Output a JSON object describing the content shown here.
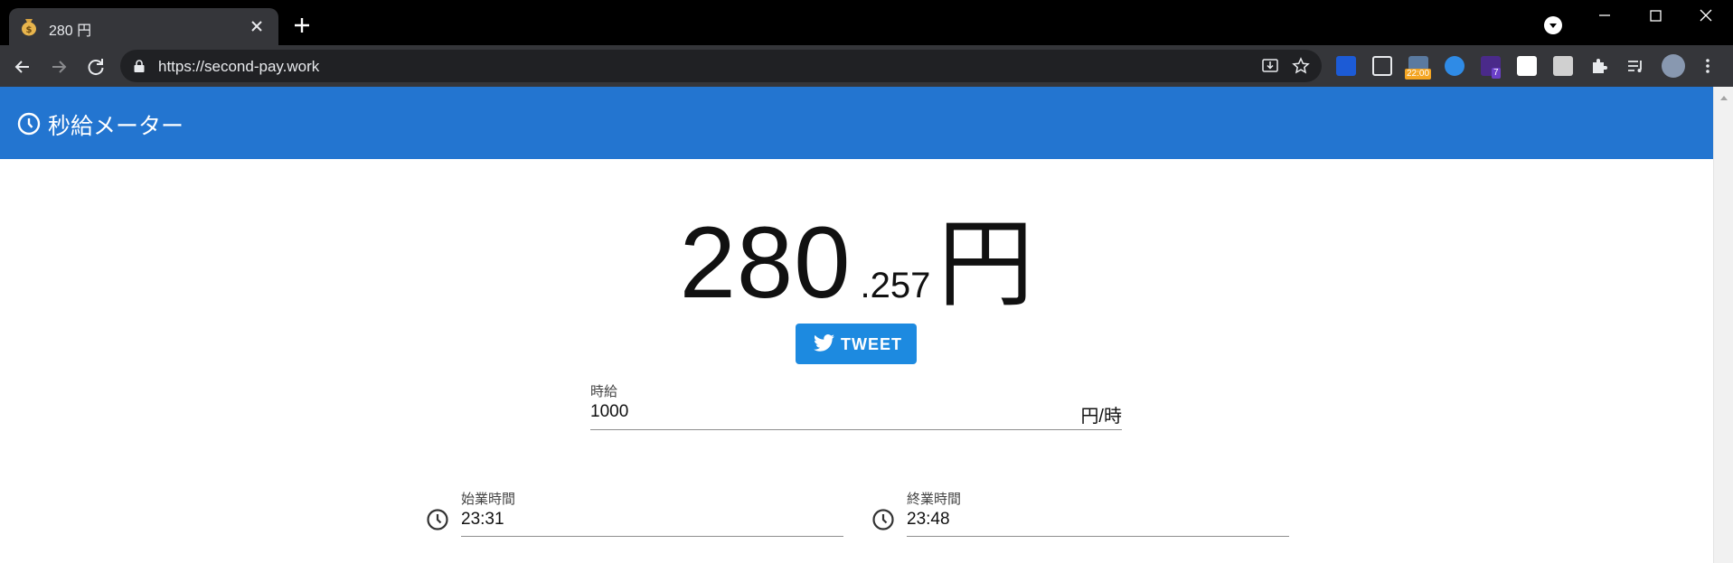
{
  "browser": {
    "tab_title": "280 円",
    "url": "https://second-pay.work",
    "extension_badges": {
      "clock": "22:00",
      "count": "7"
    }
  },
  "app": {
    "title": "秒給メーター",
    "accent_color": "#2375d0"
  },
  "meter": {
    "integer": "280",
    "decimal": ".257",
    "unit": "円"
  },
  "tweet_button": {
    "label": "TWEET",
    "color": "#1d8ae0"
  },
  "form": {
    "hourly_wage": {
      "label": "時給",
      "value": "1000",
      "suffix": "円/時"
    },
    "start_time": {
      "label": "始業時間",
      "value": "23:31"
    },
    "end_time": {
      "label": "終業時間",
      "value": "23:48"
    }
  }
}
